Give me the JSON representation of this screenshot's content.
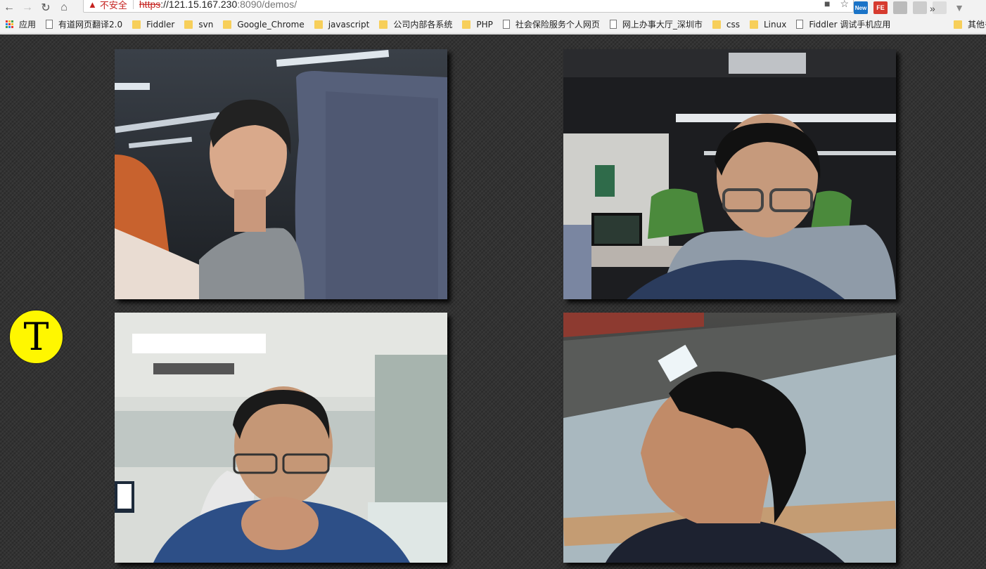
{
  "browser": {
    "security_label": "不安全",
    "url_protocol": "https",
    "url_host": "://121.15.167.230",
    "url_rest": ":8090/demos/",
    "ext_new_label": "New",
    "ext_fe_label": "FE"
  },
  "bookmarks": [
    {
      "label": "应用",
      "icon": "apps-icon"
    },
    {
      "label": "有道网页翻译2.0",
      "icon": "page-icon"
    },
    {
      "label": "Fiddler",
      "icon": "folder-icon"
    },
    {
      "label": "svn",
      "icon": "folder-icon"
    },
    {
      "label": "Google_Chrome",
      "icon": "folder-icon"
    },
    {
      "label": "javascript",
      "icon": "folder-icon"
    },
    {
      "label": "公司内部各系统",
      "icon": "folder-icon"
    },
    {
      "label": "PHP",
      "icon": "folder-icon"
    },
    {
      "label": "社会保险服务个人网页",
      "icon": "page-icon"
    },
    {
      "label": "网上办事大厅_深圳市",
      "icon": "page-icon"
    },
    {
      "label": "css",
      "icon": "folder-icon"
    },
    {
      "label": "Linux",
      "icon": "folder-icon"
    },
    {
      "label": "Fiddler 调试手机应用",
      "icon": "page-icon"
    }
  ],
  "bookmarks_overflow": "»",
  "other_bookmarks": "其他书签",
  "badge": {
    "letter": "T",
    "color": "#fff700"
  },
  "videos": [
    {
      "name": "participant-1",
      "scene": "office-seat"
    },
    {
      "name": "participant-2",
      "scene": "office-glasses"
    },
    {
      "name": "participant-3",
      "scene": "office-window"
    },
    {
      "name": "participant-4",
      "scene": "dark-office-side"
    }
  ]
}
